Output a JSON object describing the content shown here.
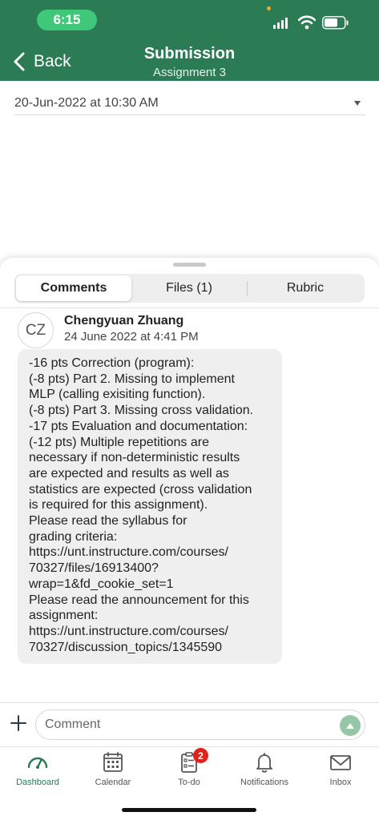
{
  "status_bar": {
    "time": "6:15"
  },
  "header": {
    "back_label": "Back",
    "title": "Submission",
    "subtitle": "Assignment 3"
  },
  "submission_select": {
    "selected": "20-Jun-2022 at 10:30 AM"
  },
  "tabs": [
    {
      "label": "Comments",
      "active": true
    },
    {
      "label": "Files (1)",
      "active": false
    },
    {
      "label": "Rubric",
      "active": false
    }
  ],
  "comment": {
    "initials": "CZ",
    "author": "Chengyuan Zhuang",
    "date": "24 June 2022 at 4:41 PM",
    "lines": [
      "-16 pts Correction (program):",
      "(-8 pts) Part 2. Missing to implement",
      "MLP (calling exisiting function).",
      "(-8 pts) Part 3. Missing cross validation.",
      "-17 pts Evaluation and documentation:",
      "(-12 pts) Multiple repetitions are",
      "necessary if non-deterministic results",
      "are expected and results as well as",
      "statistics are expected (cross validation",
      "is required for this assignment).",
      "Please read the syllabus for",
      "grading criteria:",
      "https://unt.instructure.com/courses/",
      "70327/files/16913400?",
      "wrap=1&fd_cookie_set=1",
      "Please read the announcement for this",
      "assignment:",
      "https://unt.instructure.com/courses/",
      "70327/discussion_topics/1345590"
    ]
  },
  "comment_input": {
    "placeholder": "Comment"
  },
  "tabbar": [
    {
      "label": "Dashboard",
      "icon": "dashboard-icon",
      "active": true
    },
    {
      "label": "Calendar",
      "icon": "calendar-icon",
      "active": false
    },
    {
      "label": "To-do",
      "icon": "todo-icon",
      "active": false,
      "badge": "2"
    },
    {
      "label": "Notifications",
      "icon": "bell-icon",
      "active": false
    },
    {
      "label": "Inbox",
      "icon": "mail-icon",
      "active": false
    }
  ],
  "colors": {
    "brand_green": "#2b7b55",
    "status_pill": "#3fc87a",
    "badge_red": "#e0221b"
  }
}
